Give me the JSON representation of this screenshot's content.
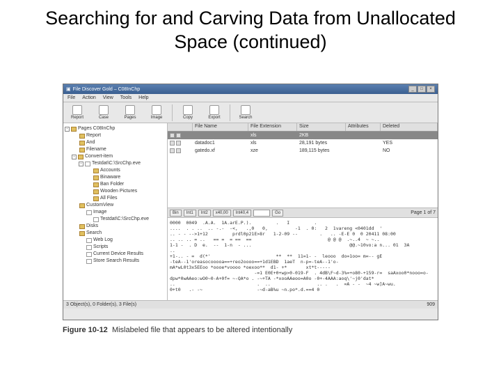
{
  "slide_title": "Searching for and Carving Data from Unallocated Space (continued)",
  "app_title": "File Discover Gold – C08InChp",
  "menus": [
    "File",
    "Action",
    "View",
    "Tools",
    "Help"
  ],
  "toolbar": [
    {
      "label": "Report"
    },
    {
      "label": "Case"
    },
    {
      "label": "Pages"
    },
    {
      "label": "Image"
    },
    {
      "label": "Copy"
    },
    {
      "label": "Export"
    },
    {
      "label": "Search"
    }
  ],
  "tree": {
    "root": "Pages  C08InChp",
    "items": [
      {
        "lvl": 1,
        "icon": "fld",
        "label": "Report"
      },
      {
        "lvl": 1,
        "icon": "fld",
        "label": "And"
      },
      {
        "lvl": 1,
        "icon": "fld",
        "label": "Filename"
      },
      {
        "lvl": 1,
        "icon": "fld",
        "label": "Convert-item",
        "exp": true
      },
      {
        "lvl": 2,
        "icon": "fil",
        "label": "Testdat\\C:\\SrcChp.eve",
        "exp": true
      },
      {
        "lvl": 3,
        "icon": "fld",
        "label": "Accounts"
      },
      {
        "lvl": 3,
        "icon": "fld",
        "label": "Binaware"
      },
      {
        "lvl": 3,
        "icon": "fld",
        "label": "Ban Folder"
      },
      {
        "lvl": 3,
        "icon": "fld",
        "label": "Wooden Pictures"
      },
      {
        "lvl": 3,
        "icon": "fld",
        "label": "All Files"
      },
      {
        "lvl": 1,
        "icon": "fld",
        "label": "CustomView"
      },
      {
        "lvl": 2,
        "icon": "fil",
        "label": "Image"
      },
      {
        "lvl": 3,
        "icon": "fil",
        "label": "Testdat\\C:\\SrcChp.eve"
      },
      {
        "lvl": 1,
        "icon": "fld",
        "label": "Disks"
      },
      {
        "lvl": 1,
        "icon": "fld",
        "label": "Search"
      },
      {
        "lvl": 2,
        "icon": "fil",
        "label": "Web Log"
      },
      {
        "lvl": 2,
        "icon": "fil",
        "label": "Scripts"
      },
      {
        "lvl": 2,
        "icon": "fil",
        "label": "Current Device Results"
      },
      {
        "lvl": 2,
        "icon": "fil",
        "label": "Store Search Results"
      }
    ]
  },
  "columns": [
    "",
    "File Name",
    "File Extension",
    "Size",
    "Attributes",
    "Deleted"
  ],
  "rows": [
    {
      "name": "",
      "ext": "xls",
      "size": "2KB",
      "attr": "",
      "del": "",
      "sel": true
    },
    {
      "name": "datadoc1",
      "ext": "xls",
      "size": "28,191 bytes",
      "attr": "",
      "del": "YES",
      "sel": false
    },
    {
      "name": "gatedo.xf",
      "ext": "xze",
      "size": "189,115 bytes",
      "attr": "",
      "del": "NO",
      "sel": false
    }
  ],
  "hexbar": {
    "btns": [
      "Bin",
      "Int1",
      "Int2",
      "x40,00",
      "Int40,4"
    ],
    "go": "Go",
    "page": "Page 1 of 7"
  },
  "hexdump": "0000  0049  .A.A.  1A.arE.P.).         .   I         .\n....  . . ..  .. -.-  -<,   .,0   0,          -1  . 0:   2  1vareng <0401dd  '\n.. - - -->1+12         prdl0p21E>8r   1-2-09 --        .   .. -E-E 0  0 20411 08:00\n.. .. .. = ..   == =  = ==  ==                            @ @ @  .~..4  ~ ~..\n1-1 -  . D  e.  --  1-n  - ...                                    @@.~10vo:a n... 01  3A\n..\n+1-.. - =  d(*'                        **  **  11=1- -  leooo  do=1oo= m=-- gE\n-teA--1'oreasocooooa==+reo2oooo==+1d1EBD  1aeT  n-p=-teA--1'o-\nmA*wL0t3x5EEoo *oooe*voooo *oexoo**  d1- +*       xt*t-----\n                               -=1 E0E+0+wp>0-019-F  . 4dB\\F~d-3%=+o80-+159-r=  saAxoo0*nooo=o-\ndpw*0wAAeo:wO0~0-A+0f= ~-QA*o . -~+TA -*xooAAeoo=A0o -0+-4AAA:aoq\\'~j0'dat*\n..                              .  ..                 .. .   .  =A - -  ~4 ~w]A~wu.\n0+t0   .- -~                    -~d-aB%u ~n.po*.d.==4 0",
  "statusbar": {
    "left": "3 Object(s), 0 Folder(s), 3 File(s)",
    "right": "909"
  },
  "caption_num": "Figure 10-12",
  "caption_text": "Mislabeled file that appears to be altered intentionally"
}
